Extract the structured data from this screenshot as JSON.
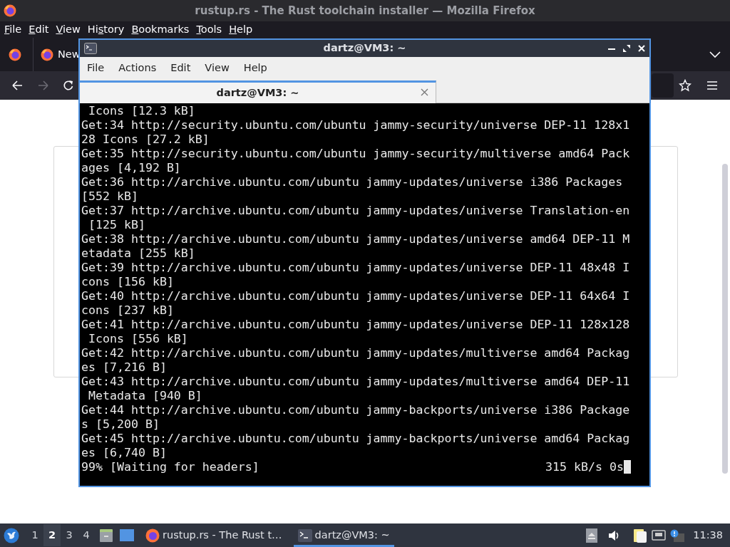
{
  "browser": {
    "title": "rustup.rs - The Rust toolchain installer — Mozilla Firefox",
    "menu": [
      {
        "accel": "F",
        "after": "ile"
      },
      {
        "accel": "E",
        "after": "dit"
      },
      {
        "accel": "V",
        "after": "iew"
      },
      {
        "before": "Hi",
        "accel": "s",
        "after": "tory"
      },
      {
        "accel": "B",
        "after": "ookmarks"
      },
      {
        "accel": "T",
        "after": "ools"
      },
      {
        "accel": "H",
        "after": "elp"
      }
    ],
    "tabs": [
      {
        "label": "New",
        "selected": false
      }
    ],
    "nav": {
      "back_disabled": false,
      "forward_disabled": true
    }
  },
  "terminal": {
    "title": "dartz@VM3: ~",
    "menu": [
      "File",
      "Actions",
      "Edit",
      "View",
      "Help"
    ],
    "tabs": [
      {
        "label": "dartz@VM3: ~",
        "selected": true
      }
    ],
    "lines": [
      " Icons [12.3 kB]",
      "Get:34 http://security.ubuntu.com/ubuntu jammy-security/universe DEP-11 128x1",
      "28 Icons [27.2 kB]",
      "Get:35 http://security.ubuntu.com/ubuntu jammy-security/multiverse amd64 Pack",
      "ages [4,192 B]",
      "Get:36 http://archive.ubuntu.com/ubuntu jammy-updates/universe i386 Packages",
      "[552 kB]",
      "Get:37 http://archive.ubuntu.com/ubuntu jammy-updates/universe Translation-en",
      " [125 kB]",
      "Get:38 http://archive.ubuntu.com/ubuntu jammy-updates/universe amd64 DEP-11 M",
      "etadata [255 kB]",
      "Get:39 http://archive.ubuntu.com/ubuntu jammy-updates/universe DEP-11 48x48 I",
      "cons [156 kB]",
      "Get:40 http://archive.ubuntu.com/ubuntu jammy-updates/universe DEP-11 64x64 I",
      "cons [237 kB]",
      "Get:41 http://archive.ubuntu.com/ubuntu jammy-updates/universe DEP-11 128x128",
      " Icons [556 kB]",
      "Get:42 http://archive.ubuntu.com/ubuntu jammy-updates/multiverse amd64 Packag",
      "es [7,216 B]",
      "Get:43 http://archive.ubuntu.com/ubuntu jammy-updates/multiverse amd64 DEP-11",
      " Metadata [940 B]",
      "Get:44 http://archive.ubuntu.com/ubuntu jammy-backports/universe i386 Package",
      "s [5,200 B]",
      "Get:45 http://archive.ubuntu.com/ubuntu jammy-backports/universe amd64 Packag",
      "es [6,740 B]"
    ],
    "status": {
      "progress": "99% [Waiting for headers]",
      "rate": "315 kB/s 0s"
    }
  },
  "taskbar": {
    "desktops": [
      {
        "label": "1",
        "selected": false
      },
      {
        "label": "2",
        "selected": true
      },
      {
        "label": "3",
        "selected": false
      },
      {
        "label": "4",
        "selected": false
      }
    ],
    "tasks": [
      {
        "kind": "browser",
        "label": "rustup.rs - The Rust t…",
        "selected": false
      },
      {
        "kind": "terminal",
        "label": "dartz@VM3: ~",
        "selected": true
      }
    ],
    "clock": "11:38"
  }
}
